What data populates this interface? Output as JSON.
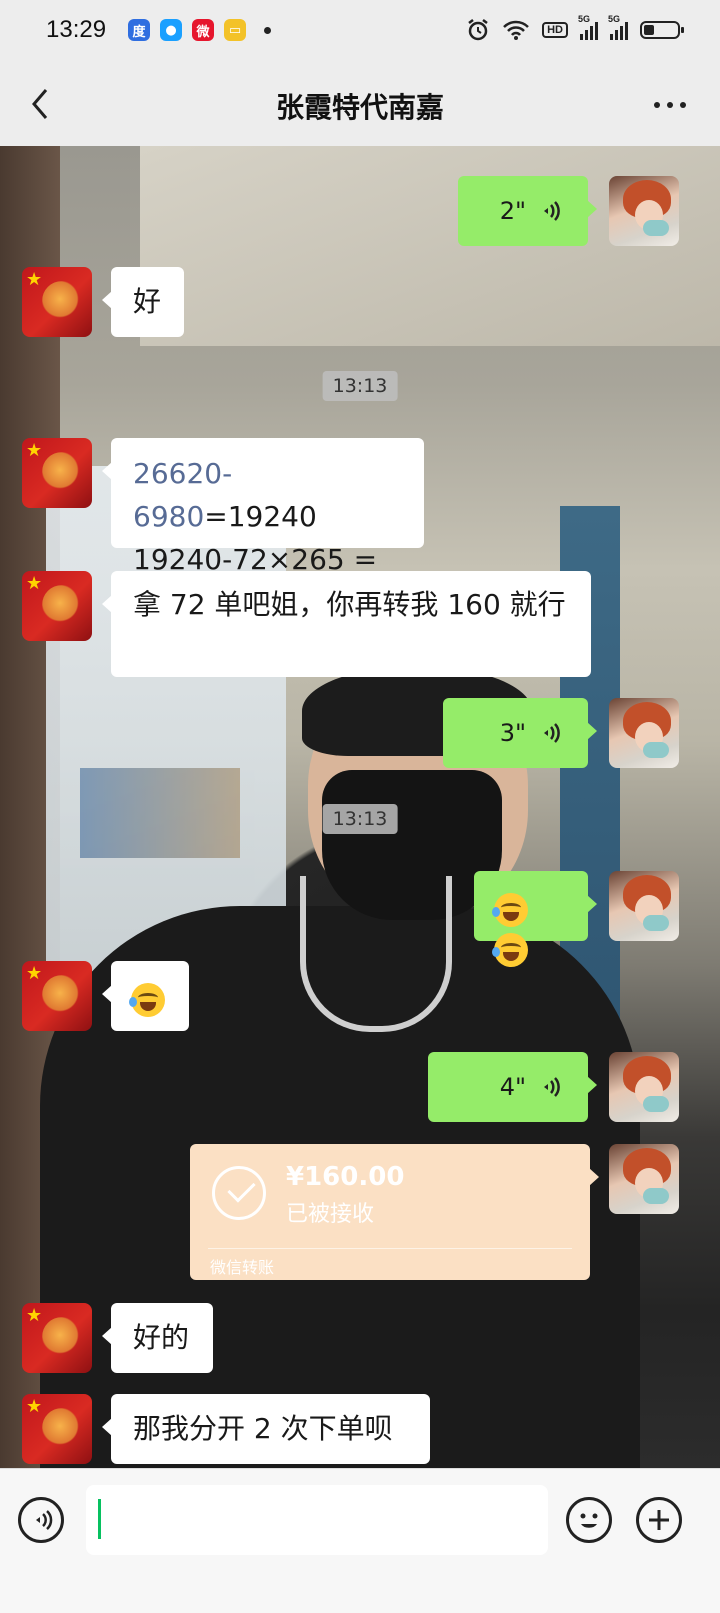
{
  "status_bar": {
    "time": "13:29",
    "apps": [
      {
        "name": "baidu-app-icon",
        "glyph": "度",
        "color": "#2f6ee0"
      },
      {
        "name": "circle-app-icon",
        "glyph": "●",
        "color": "#1aa0ff"
      },
      {
        "name": "weibo-app-icon",
        "glyph": "微",
        "color": "#e6162d"
      },
      {
        "name": "notes-app-icon",
        "glyph": "▭",
        "color": "#f3c228"
      }
    ],
    "hd_label": "HD",
    "signal_labels": [
      "5G",
      "5G"
    ],
    "battery_level": 0.3
  },
  "nav": {
    "title": "张霞特代南嘉"
  },
  "messages": {
    "m1_voice": "2\"",
    "m2_text": "好",
    "t1": "13:13",
    "m3_line1_link": "26620-6980",
    "m3_line1_rest": "=19240",
    "m3_line2": "19240-72×265 = 160",
    "m4_text": "拿 72 单吧姐，你再转我 160 就行",
    "m5_voice": "3\"",
    "t2": "13:13",
    "m8_voice": "4\"",
    "transfer": {
      "amount": "¥160.00",
      "status": "已被接收",
      "footer": "微信转账"
    },
    "m10_text": "好的",
    "m11_text": "那我分开 2 次下单呗"
  },
  "colors": {
    "outgoing_bubble": "#95ec69",
    "incoming_bubble": "#ffffff",
    "link": "#576b95",
    "transfer_bg": "#fbe0c4"
  }
}
